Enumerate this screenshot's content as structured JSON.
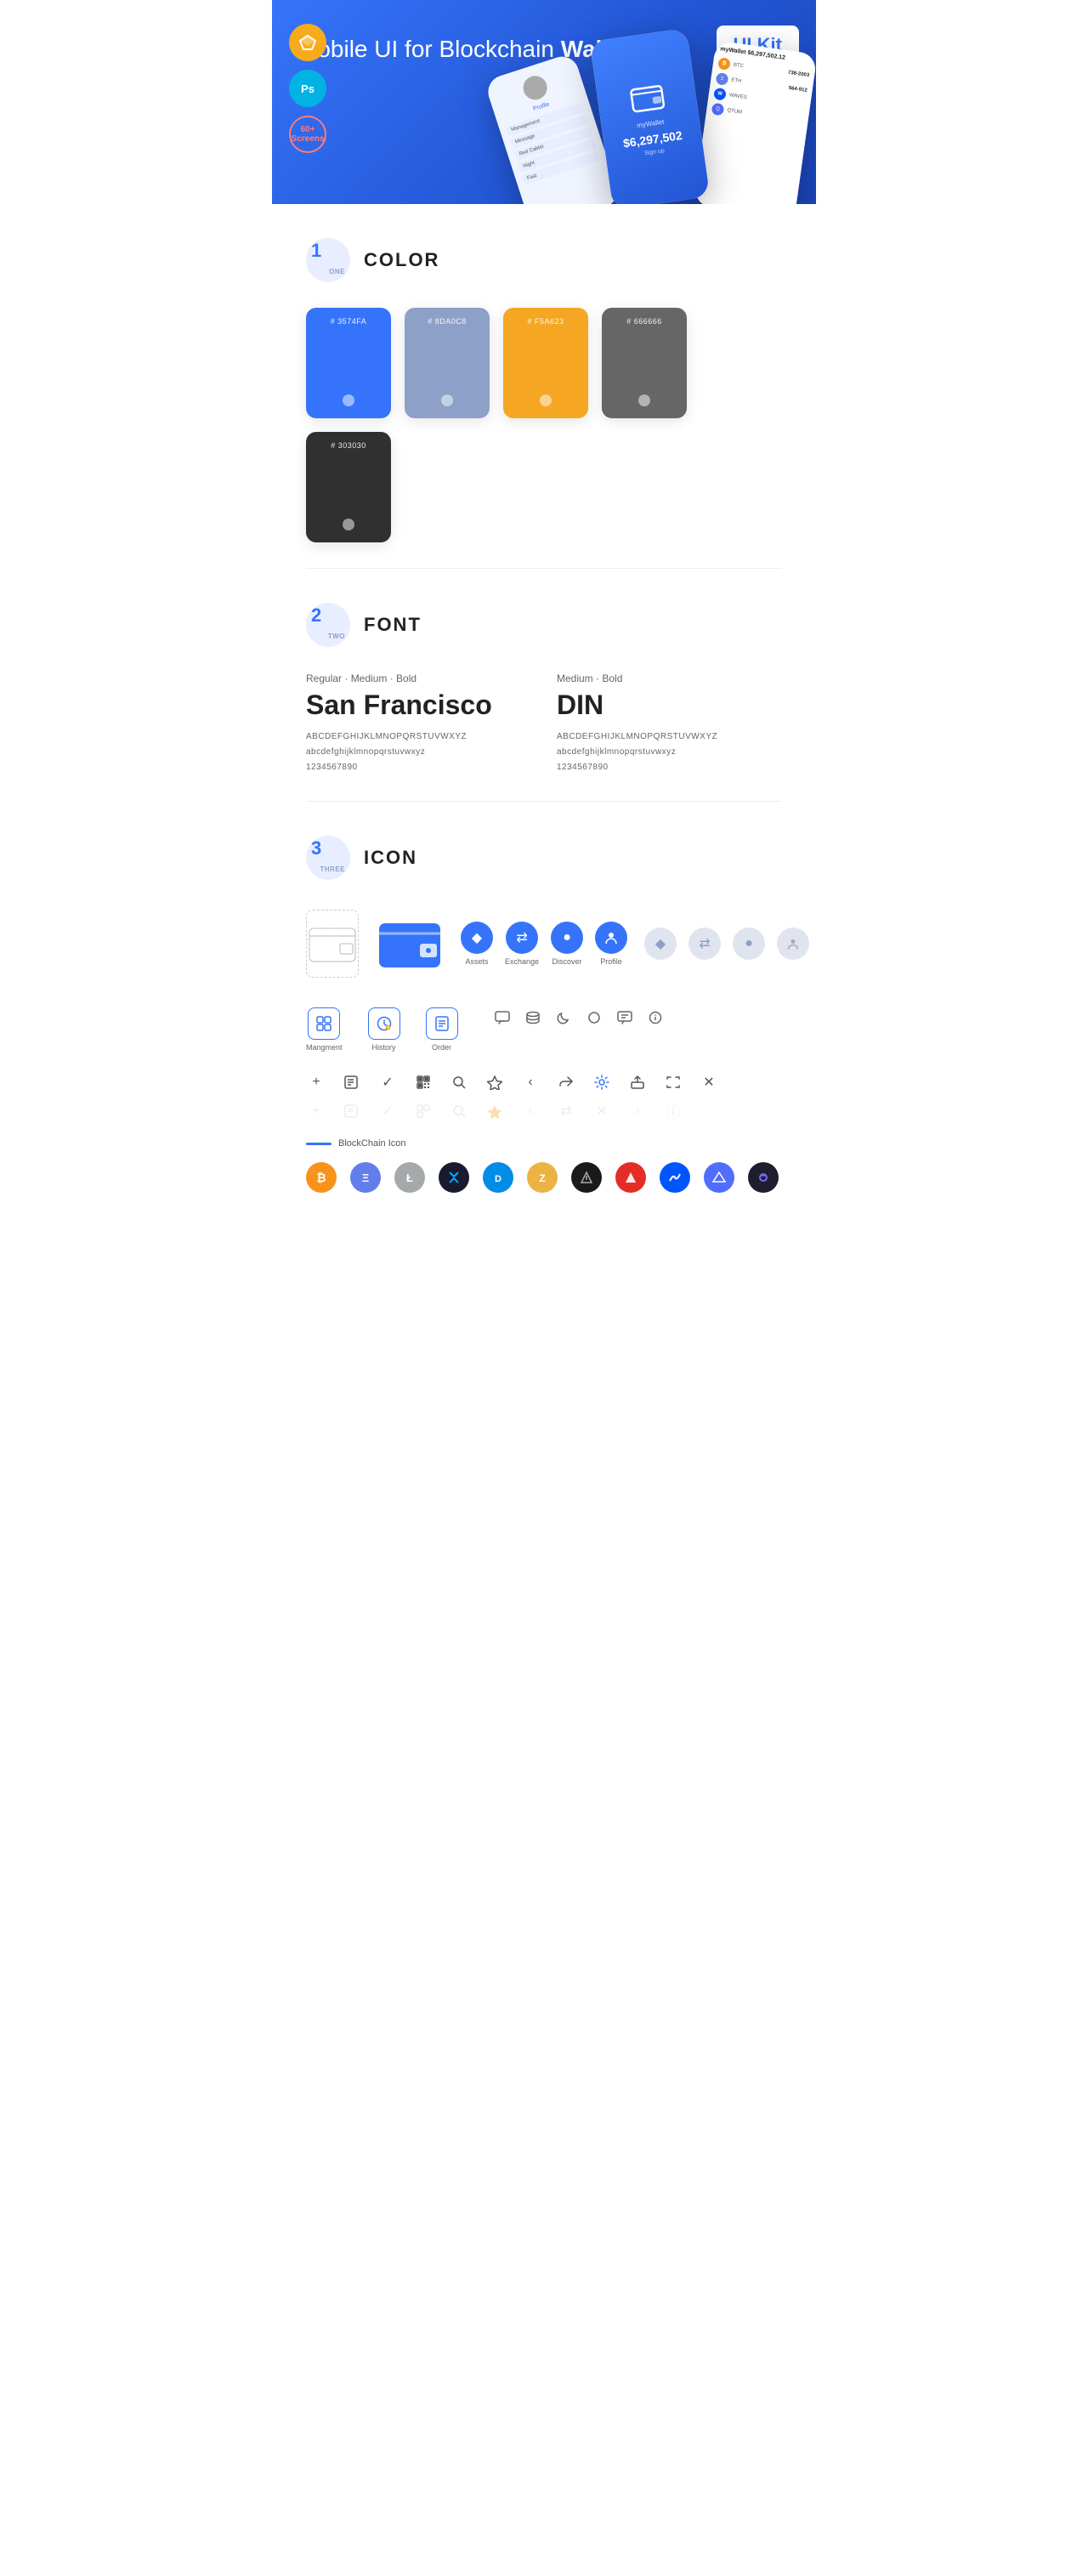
{
  "hero": {
    "title": "Mobile UI for Blockchain ",
    "title_bold": "Wallet",
    "ui_kit_badge": "UI Kit",
    "badge_sketch": "S",
    "badge_ps": "Ps",
    "badge_screens": "60+\nScreens"
  },
  "sections": {
    "color": {
      "number": "1",
      "sub": "ONE",
      "title": "COLOR",
      "swatches": [
        {
          "hex": "#3574FA",
          "label": "#\n3574FA"
        },
        {
          "hex": "#8DA0C8",
          "label": "#\n8DA0C8"
        },
        {
          "hex": "#F5A623",
          "label": "#\nF5A623"
        },
        {
          "hex": "#666666",
          "label": "#\n666666"
        },
        {
          "hex": "#303030",
          "label": "#\n303030"
        }
      ]
    },
    "font": {
      "number": "2",
      "sub": "TWO",
      "title": "FONT",
      "font1": {
        "weights": "Regular · Medium · Bold",
        "name": "San Francisco",
        "upper": "ABCDEFGHIJKLMNOPQRSTUVWXYZ",
        "lower": "abcdefghijklmnopqrstuvwxyz",
        "nums": "1234567890"
      },
      "font2": {
        "weights": "Medium · Bold",
        "name": "DIN",
        "upper": "ABCDEFGHIJKLMNOPQRSTUVWXYZ",
        "lower": "abcdefghijklmnopqrstuvwxyz",
        "nums": "1234567890"
      }
    },
    "icon": {
      "number": "3",
      "sub": "THREE",
      "title": "ICON",
      "nav_items": [
        {
          "label": "Assets",
          "icon": "◆"
        },
        {
          "label": "Exchange",
          "icon": "⇄"
        },
        {
          "label": "Discover",
          "icon": "●"
        },
        {
          "label": "Profile",
          "icon": "👤"
        }
      ],
      "app_icons": [
        {
          "label": "Mangment",
          "icon": "▤"
        },
        {
          "label": "History",
          "icon": "🕐"
        },
        {
          "label": "Order",
          "icon": "📋"
        }
      ],
      "blockchain_label": "BlockChain Icon",
      "crypto_icons": [
        {
          "label": "BTC",
          "symbol": "₿",
          "class": "crypto-btc"
        },
        {
          "label": "ETH",
          "symbol": "Ξ",
          "class": "crypto-eth"
        },
        {
          "label": "LTC",
          "symbol": "Ł",
          "class": "crypto-ltc"
        },
        {
          "label": "XRP",
          "symbol": "✦",
          "class": "crypto-xrp"
        },
        {
          "label": "DASH",
          "symbol": "D",
          "class": "crypto-dash"
        },
        {
          "label": "ZEC",
          "symbol": "Z",
          "class": "crypto-zcash"
        },
        {
          "label": "IOTA",
          "symbol": "⬡",
          "class": "crypto-iota"
        },
        {
          "label": "ARK",
          "symbol": "▲",
          "class": "crypto-ark"
        },
        {
          "label": "WAVES",
          "symbol": "W",
          "class": "crypto-waves"
        },
        {
          "label": "BAND",
          "symbol": "◆",
          "class": "crypto-band"
        },
        {
          "label": "BAL",
          "symbol": "◉",
          "class": "crypto-bal"
        }
      ]
    }
  }
}
